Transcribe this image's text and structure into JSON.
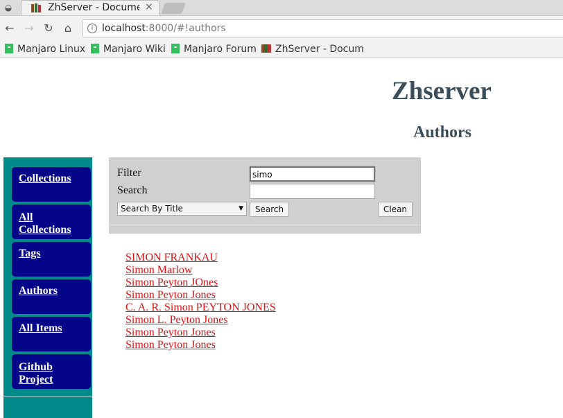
{
  "browser": {
    "tab_title": "ZhServer - Documen",
    "tab_close": "×",
    "url_host": "localhost",
    "url_rest": ":8000/#!authors",
    "bookmarks": [
      {
        "label": "Manjaro Linux",
        "icon": "manjaro-logo-icon"
      },
      {
        "label": "Manjaro Wiki",
        "icon": "manjaro-logo-icon"
      },
      {
        "label": "Manjaro Forum",
        "icon": "manjaro-logo-icon"
      },
      {
        "label": "ZhServer - Docum",
        "icon": "books-icon"
      }
    ]
  },
  "page": {
    "site_title": "Zhserver",
    "section_title": "Authors"
  },
  "sidebar": {
    "items": [
      {
        "label": "Collections"
      },
      {
        "label": "All Collections"
      },
      {
        "label": "Tags"
      },
      {
        "label": "Authors"
      },
      {
        "label": "All Items"
      },
      {
        "label": "Github Project"
      }
    ]
  },
  "filter": {
    "filter_label": "Filter",
    "filter_value": "simo",
    "search_label": "Search",
    "search_value": "",
    "search_mode": "Search By Title",
    "search_button": "Search",
    "clean_button": "Clean"
  },
  "authors": [
    "SIMON FRANKAU",
    "Simon Marlow",
    "Simon Peyton JOnes",
    "Simon Peyton Jones",
    "C. A. R. Simon PEYTON JONES",
    "Simon L. Peyton Jones",
    "Simon Peyton Jones",
    "Simon Peyton Jones"
  ],
  "colors": {
    "sidebar_bg": "#008b8b",
    "nav_item_bg": "#05058a",
    "link_color": "#e01010",
    "title_color": "#3b4d5a"
  }
}
